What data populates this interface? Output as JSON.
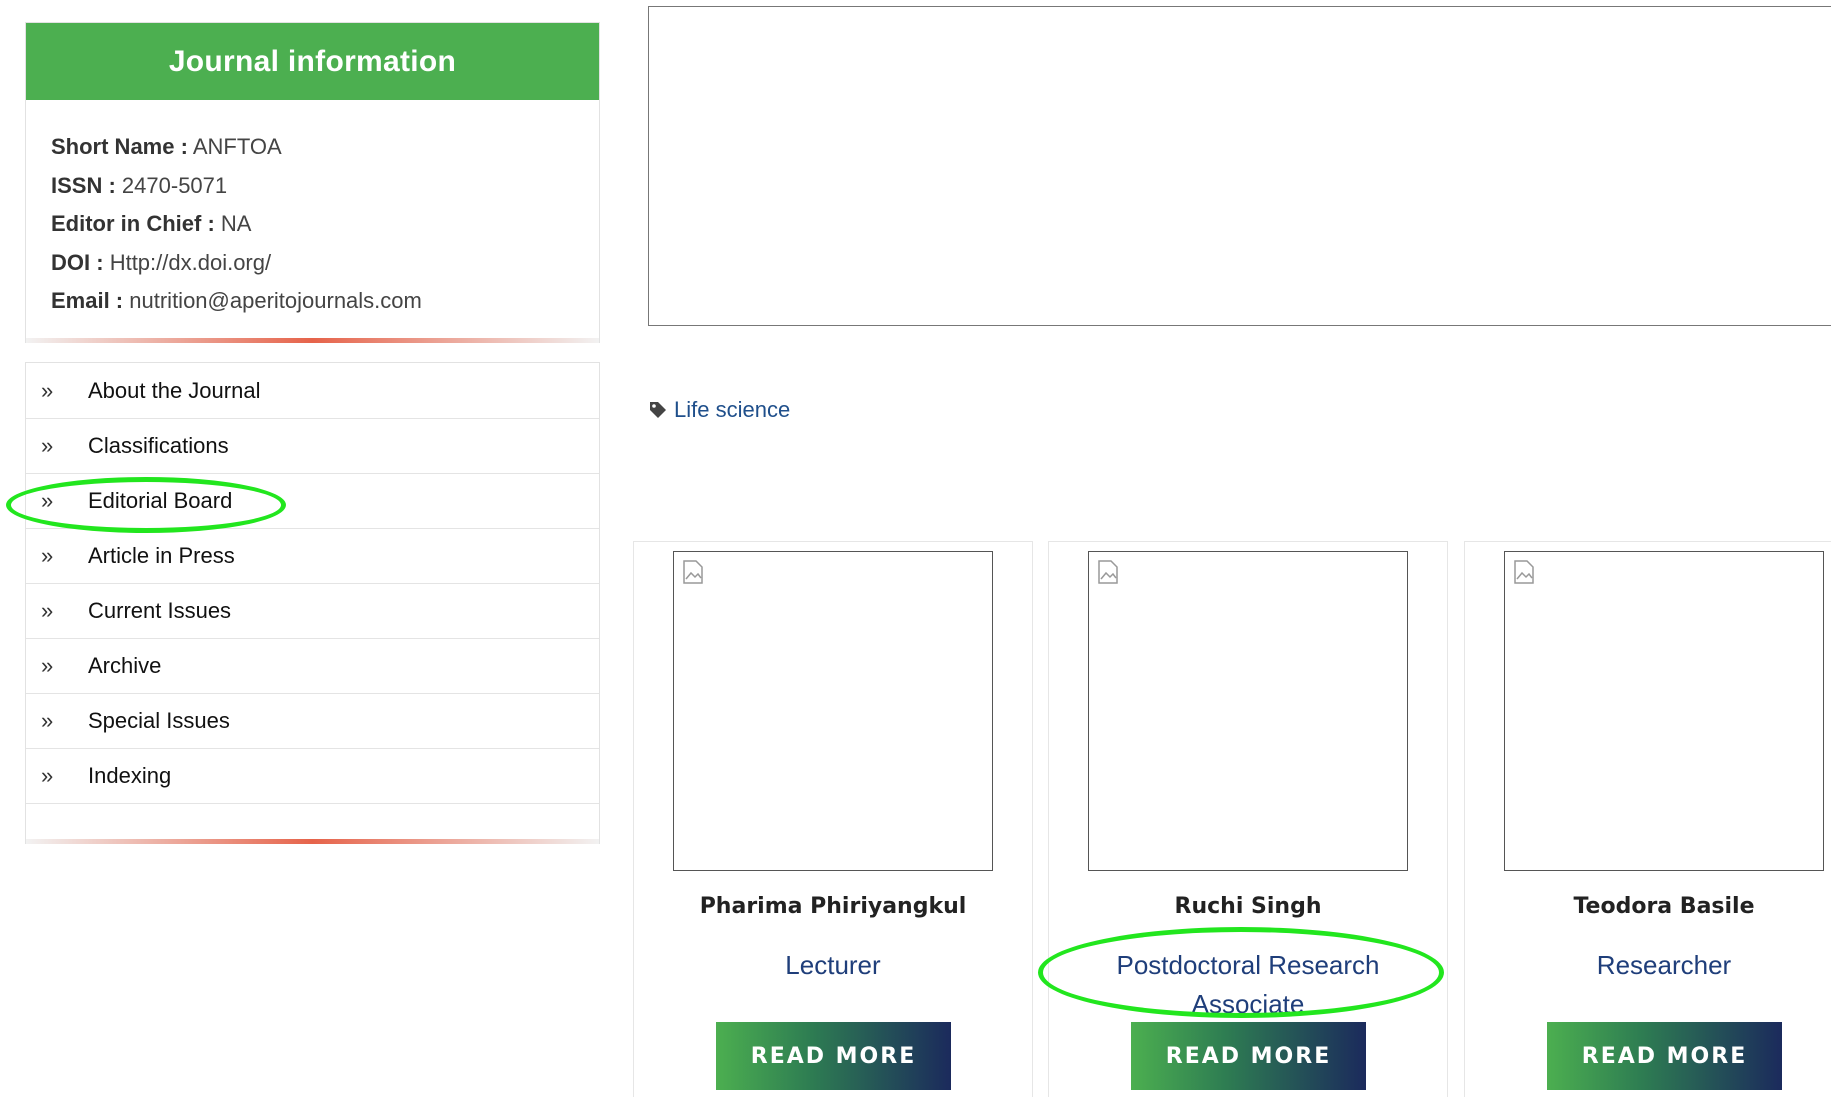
{
  "sidebar": {
    "info_title": "Journal information",
    "info_rows": [
      {
        "label": "Short Name :",
        "value": "ANFTOA"
      },
      {
        "label": "ISSN :",
        "value": "2470-5071"
      },
      {
        "label": "Editor in Chief :",
        "value": "NA"
      },
      {
        "label": "DOI :",
        "value": "Http://dx.doi.org/"
      },
      {
        "label": "Email :",
        "value": "nutrition@aperitojournals.com"
      }
    ],
    "nav_chevron": "»",
    "nav": [
      {
        "label": "About the Journal"
      },
      {
        "label": "Classifications"
      },
      {
        "label": "Editorial Board"
      },
      {
        "label": "Article in Press"
      },
      {
        "label": "Current Issues"
      },
      {
        "label": "Archive"
      },
      {
        "label": "Special Issues"
      },
      {
        "label": "Indexing"
      }
    ]
  },
  "main": {
    "tag_icon": "tag-icon",
    "tag_label": "Life science",
    "members": [
      {
        "name": "Pharima Phiriyangkul",
        "role": "Lecturer",
        "button": "READ MORE"
      },
      {
        "name": "Ruchi Singh",
        "role": "Postdoctoral Research Associate",
        "button": "READ MORE"
      },
      {
        "name": "Teodora Basile",
        "role": "Researcher",
        "button": "READ MORE"
      }
    ]
  },
  "colors": {
    "header_green": "#4caf50",
    "link_blue": "#1f4f8b",
    "role_blue": "#1f3e7a",
    "accent_orange": "#e6634a",
    "annotation_green": "#22e61e"
  }
}
